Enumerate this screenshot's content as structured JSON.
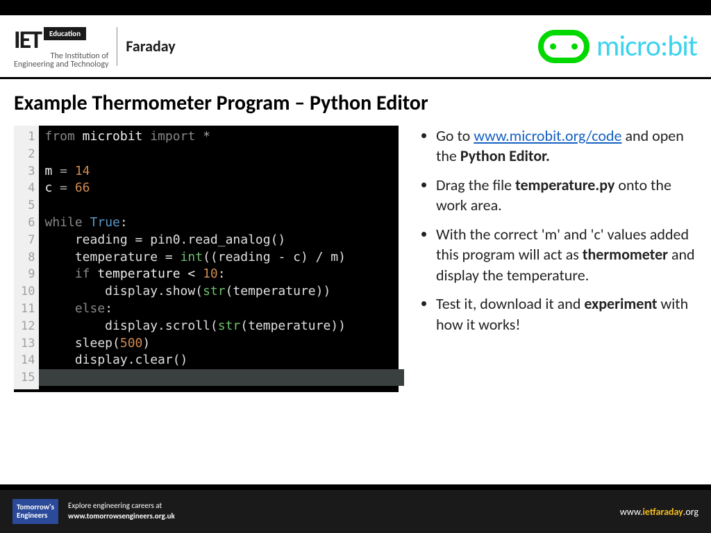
{
  "header": {
    "iet": "IET",
    "edu": "Education",
    "sub1": "The Institution of",
    "sub2": "Engineering and Technology",
    "faraday": "Faraday",
    "microbit": "micro:bit"
  },
  "title": "Example Thermometer Program – Python Editor",
  "code": {
    "lines": [
      "1",
      "2",
      "3",
      "4",
      "5",
      "6",
      "7",
      "8",
      "9",
      "10",
      "11",
      "12",
      "13",
      "14",
      "15"
    ],
    "l1_kw1": "from ",
    "l1_name": "microbit",
    "l1_kw2": " import ",
    "l1_star": "*",
    "l3_var": "m",
    "l3_eq": " = ",
    "l3_val": "14",
    "l4_var": "c",
    "l4_eq": " = ",
    "l4_val": "66",
    "l6_kw": "while ",
    "l6_val": "True",
    "l6_colon": ":",
    "l7": "    reading = pin0.read_analog()",
    "l8a": "    temperature = ",
    "l8_fn": "int",
    "l8b": "((reading - c) / m)",
    "l9a": "    ",
    "l9_kw": "if",
    "l9b": " temperature < ",
    "l9_num": "10",
    "l9c": ":",
    "l10a": "        display.show(",
    "l10_fn": "str",
    "l10b": "(temperature))",
    "l11a": "    ",
    "l11_kw": "else",
    "l11b": ":",
    "l12a": "        display.scroll(",
    "l12_fn": "str",
    "l12b": "(temperature))",
    "l13a": "    sleep(",
    "l13_num": "500",
    "l13b": ")",
    "l14": "    display.clear()"
  },
  "bullets": {
    "b1a": "Go to ",
    "b1_link": "www.microbit.org/code",
    "b1b": " and open the ",
    "b1_bold": "Python Editor.",
    "b2a": "Drag the file ",
    "b2_bold": "temperature.py",
    "b2b": " onto the work area.",
    "b3a": "With the correct 'm' and 'c' values added this program will act as ",
    "b3_bold": "thermometer",
    "b3b": " and display the temperature.",
    "b4a": "Test it, download it and ",
    "b4_bold": "experiment",
    "b4b": " with how it works!"
  },
  "footer": {
    "te1": "Tomorrow's",
    "te2": "Engineers",
    "line1": "Explore engineering careers at",
    "line2": "www.tomorrowsengineers.org.uk",
    "r1": "www.",
    "r2": "ietfaraday",
    "r3": ".org"
  }
}
